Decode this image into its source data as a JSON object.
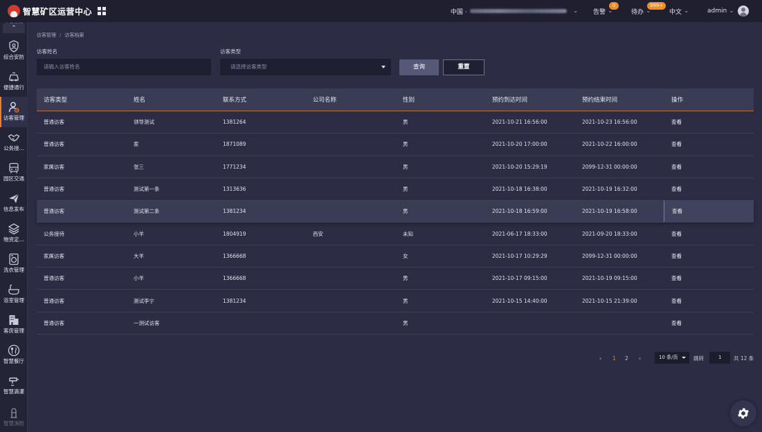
{
  "header": {
    "app_title": "智慧矿区运营中心",
    "region_prefix": "中国 ·",
    "alarm_label": "告警",
    "alarm_count": "0",
    "todo_label": "待办",
    "todo_count": "999+",
    "language": "中文",
    "user": "admin"
  },
  "sidebar": {
    "top_faded": "公共安防",
    "bottom_faded": "智慧消防",
    "items": [
      {
        "label": "综合安防",
        "icon": "shield-person-icon"
      },
      {
        "label": "便捷通行",
        "icon": "car-icon"
      },
      {
        "label": "访客管理",
        "icon": "visitor-icon"
      },
      {
        "label": "公务接...",
        "icon": "handshake-icon"
      },
      {
        "label": "园区交通",
        "icon": "bus-icon"
      },
      {
        "label": "信息发布",
        "icon": "paper-plane-icon"
      },
      {
        "label": "物资定...",
        "icon": "layers-icon"
      },
      {
        "label": "洗衣管理",
        "icon": "washing-machine-icon"
      },
      {
        "label": "浴室管理",
        "icon": "bathtub-icon"
      },
      {
        "label": "客房管理",
        "icon": "building-icon"
      },
      {
        "label": "智慧餐厅",
        "icon": "restaurant-icon"
      },
      {
        "label": "智慧滴灌",
        "icon": "water-tap-icon"
      },
      {
        "label": "智慧消防",
        "icon": "fire-hydrant-icon"
      }
    ],
    "active_index": 2
  },
  "breadcrumb": {
    "parent": "访客管理",
    "separator": "/",
    "current": "访客档案"
  },
  "filters": {
    "name_label": "访客姓名",
    "name_placeholder": "请输入访客姓名",
    "type_label": "访客类型",
    "type_placeholder": "请选择访客类型",
    "search_button": "查询",
    "reset_button": "重置"
  },
  "table": {
    "columns": [
      "访客类型",
      "姓名",
      "联系方式",
      "公司名称",
      "性别",
      "预约到达时间",
      "预约结束时间",
      "操作"
    ],
    "rows": [
      [
        "普通访客",
        "领导测试",
        "1381264",
        "",
        "男",
        "2021-10-21 16:56:00",
        "2021-10-23 16:56:00",
        "查看"
      ],
      [
        "普通访客",
        "家",
        "1871089",
        "",
        "男",
        "2021-10-20 17:00:00",
        "2021-10-22 16:00:00",
        "查看"
      ],
      [
        "家属访客",
        "张三",
        "1771234",
        "",
        "男",
        "2021-10-20 15:29:19",
        "2099-12-31 00:00:00",
        "查看"
      ],
      [
        "普通访客",
        "测试第一条",
        "1313636",
        "",
        "男",
        "2021-10-18 16:38:00",
        "2021-10-19 16:32:00",
        "查看"
      ],
      [
        "普通访客",
        "测试第二条",
        "1381234",
        "",
        "男",
        "2021-10-18 16:59:00",
        "2021-10-19 16:58:00",
        "查看"
      ],
      [
        "公务接待",
        "小羊",
        "1804919",
        "西安",
        "未知",
        "2021-06-17 18:33:00",
        "2021-09-20 18:33:00",
        "查看"
      ],
      [
        "家属访客",
        "大羊",
        "1366668",
        "",
        "女",
        "2021-10-17 10:29:29",
        "2099-12-31 00:00:00",
        "查看"
      ],
      [
        "普通访客",
        "小羊",
        "1366668",
        "",
        "男",
        "2021-10-17 09:15:00",
        "2021-10-19 09:15:00",
        "查看"
      ],
      [
        "普通访客",
        "测试李宁",
        "1381234",
        "",
        "男",
        "2021-10-15 14:40:00",
        "2021-10-15 21:39:00",
        "查看"
      ],
      [
        "普通访客",
        "一测试访客",
        "",
        "",
        "男",
        "",
        "",
        "查看"
      ]
    ],
    "hovered_row": 4
  },
  "pagination": {
    "prev": "‹",
    "pages": [
      "1",
      "2"
    ],
    "current_page": "1",
    "next": "›",
    "page_size": "10 条/页",
    "goto_label": "跳转",
    "goto_value": "1",
    "total": "共 12 条"
  }
}
